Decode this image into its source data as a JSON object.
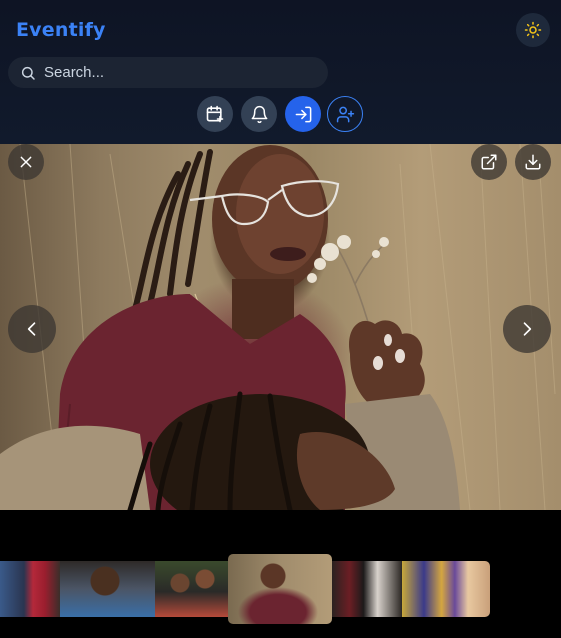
{
  "app": {
    "brand": "Eventify"
  },
  "header": {
    "theme_toggle_icon": "sun-icon",
    "search": {
      "placeholder": "Search...",
      "icon": "search-icon"
    },
    "actions": [
      {
        "name": "add-event-button",
        "icon": "calendar-plus-icon"
      },
      {
        "name": "notifications-button",
        "icon": "bell-icon"
      },
      {
        "name": "login-button",
        "icon": "log-in-icon"
      },
      {
        "name": "add-user-button",
        "icon": "user-plus-icon"
      }
    ]
  },
  "viewer": {
    "close_icon": "close-icon",
    "open_external_icon": "external-link-icon",
    "download_icon": "download-icon",
    "prev_icon": "chevron-left-icon",
    "next_icon": "chevron-right-icon"
  },
  "filmstrip": {
    "thumbnail_count": 6,
    "active_index": 3
  },
  "colors": {
    "brand": "#3b82f6",
    "header_bg": "#0f172a",
    "primary_button": "#2563eb",
    "sun": "#f5c518"
  }
}
